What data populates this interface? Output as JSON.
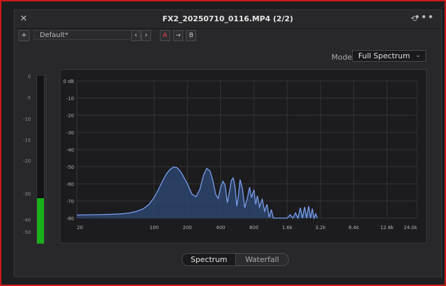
{
  "window": {
    "title": "FX2_20250710_0116.MP4 (2/2)",
    "close_glyph": "✕",
    "history_glyph": "⟲",
    "more_glyph": "•••"
  },
  "toolbar": {
    "add_glyph": "+",
    "preset_value": "Default*",
    "preset_chevron": "⌄",
    "prev_glyph": "‹",
    "next_glyph": "›",
    "ab": {
      "a": "A",
      "arrow": "→",
      "b": "B"
    }
  },
  "mode": {
    "label": "Mode",
    "value": "Full Spectrum",
    "chevron": "⌄"
  },
  "meter": {
    "labels": [
      "0",
      "-5",
      "-10",
      "-15",
      "-20",
      "-30",
      "-40",
      "-50"
    ],
    "level_fraction": 0.27,
    "fill_color": "#19b119"
  },
  "view_tabs": {
    "spectrum": "Spectrum",
    "waterfall": "Waterfall"
  },
  "chart_data": {
    "type": "area",
    "title": "",
    "xlabel": "",
    "ylabel": "",
    "x_scale": "log",
    "x_tick_labels": [
      "20",
      "100",
      "200",
      "400",
      "800",
      "1.6k",
      "3.2k",
      "6.4k",
      "12.8k",
      "24.0k"
    ],
    "y_tick_labels": [
      "0 dB",
      "-10",
      "-20",
      "-30",
      "-40",
      "-50",
      "-60",
      "-70",
      "-80"
    ],
    "ylim": [
      -80,
      0
    ],
    "xlim": [
      20,
      24000
    ],
    "grid": true,
    "line_color": "#7aa0f0",
    "fill_color": "#2f4a78",
    "series": [
      {
        "x": [
          20,
          30,
          40,
          50,
          60,
          70,
          80,
          90,
          100,
          110,
          120,
          130,
          140,
          150,
          160,
          170,
          180,
          200,
          220,
          240,
          260,
          280,
          300,
          320,
          340,
          360,
          380,
          400,
          420,
          440,
          460,
          480,
          500,
          520,
          540,
          560,
          580,
          600,
          630,
          660,
          700,
          730,
          760,
          800,
          830,
          860,
          900,
          950,
          1000,
          1050,
          1100,
          1150,
          1200,
          1250,
          1300,
          1350,
          1400,
          1450,
          1500,
          1550,
          1600,
          1700,
          1800,
          1900,
          2000,
          2100,
          2200,
          2300,
          2400,
          2500,
          2600,
          2700,
          2800,
          2900,
          3000
        ],
        "y": [
          -78.2,
          -78.0,
          -77.8,
          -77.5,
          -77.0,
          -76.0,
          -74.5,
          -72.0,
          -68.0,
          -63.0,
          -58.0,
          -54.0,
          -51.5,
          -50.2,
          -50.5,
          -52.0,
          -54.5,
          -60.0,
          -66.0,
          -67.5,
          -63.0,
          -55.0,
          -51.0,
          -52.5,
          -58.0,
          -66.0,
          -68.5,
          -62.0,
          -58.5,
          -61.0,
          -71.0,
          -65.0,
          -58.0,
          -56.5,
          -62.0,
          -73.0,
          -66.5,
          -57.5,
          -63.0,
          -74.0,
          -68.0,
          -62.0,
          -68.0,
          -63.5,
          -72.0,
          -67.0,
          -73.5,
          -69.0,
          -76.0,
          -72.0,
          -79.5,
          -75.0,
          -80.0,
          -80.0,
          -80.0,
          -80.0,
          -80.0,
          -80.0,
          -80.0,
          -80.0,
          -80.0,
          -78.0,
          -80.0,
          -77.0,
          -80.0,
          -74.0,
          -80.0,
          -73.5,
          -80.0,
          -73.0,
          -80.0,
          -74.5,
          -80.0,
          -77.5,
          -80.0
        ]
      }
    ]
  }
}
